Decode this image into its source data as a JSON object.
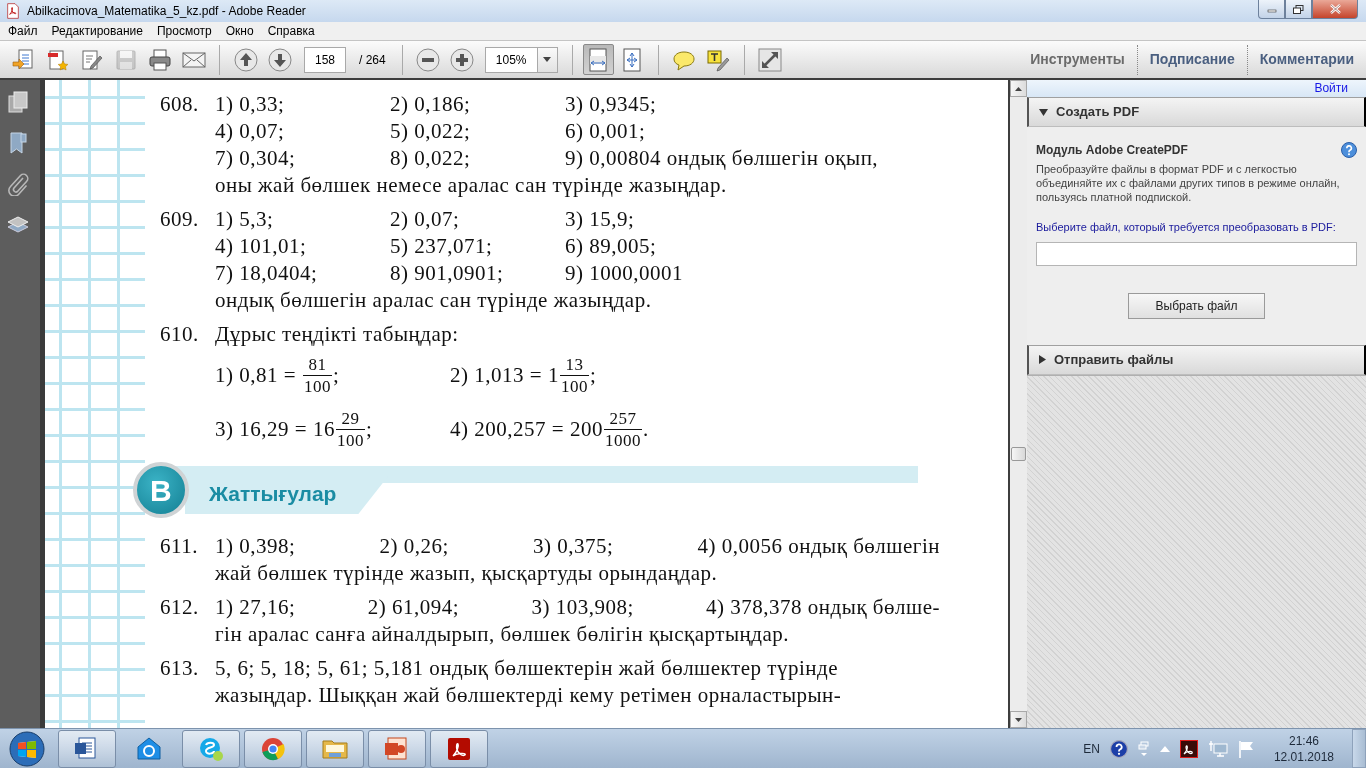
{
  "window": {
    "title": "Abilkacimova_Matematika_5_kz.pdf - Adobe Reader"
  },
  "menu": [
    "Файл",
    "Редактирование",
    "Просмотр",
    "Окно",
    "Справка"
  ],
  "toolbar": {
    "groups": [
      [
        {
          "kind": "create",
          "disabled": false,
          "pressed": false
        },
        {
          "kind": "convert",
          "disabled": false,
          "pressed": false
        },
        {
          "kind": "edit",
          "disabled": false,
          "pressed": false
        },
        {
          "kind": "save",
          "disabled": true,
          "pressed": false
        },
        {
          "kind": "print",
          "disabled": false,
          "pressed": false
        },
        {
          "kind": "email",
          "disabled": false,
          "pressed": false
        }
      ],
      [
        {
          "kind": "prev",
          "disabled": false,
          "pressed": false
        },
        {
          "kind": "next",
          "disabled": false,
          "pressed": false
        }
      ],
      [
        {
          "kind": "zoom-out",
          "disabled": false,
          "pressed": false
        },
        {
          "kind": "zoom-in",
          "disabled": false,
          "pressed": false
        }
      ],
      [
        {
          "kind": "fit-width",
          "disabled": false,
          "pressed": true
        },
        {
          "kind": "fit-page",
          "disabled": false,
          "pressed": false
        }
      ],
      [
        {
          "kind": "comment",
          "disabled": false,
          "pressed": false
        },
        {
          "kind": "highlight",
          "disabled": false,
          "pressed": false
        }
      ],
      [
        {
          "kind": "fullscreen",
          "disabled": false,
          "pressed": false
        }
      ]
    ],
    "page": "158",
    "page_total": "/ 264",
    "zoom": "105%"
  },
  "tabs": [
    {
      "label": "Инструменты",
      "selected": true
    },
    {
      "label": "Подписание",
      "selected": false
    },
    {
      "label": "Комментарии",
      "selected": false
    }
  ],
  "sign_in": "Войти",
  "panels": [
    {
      "title": "Создать PDF",
      "expanded": true,
      "heading": "Модуль Adobe CreatePDF",
      "description": "Преобразуйте файлы в формат PDF и с легкостью объединяйте их с файлами других типов в режиме онлайн, пользуясь платной подпиской.",
      "prompt": "Выберите файл, который требуется преобразовать в PDF:",
      "button": "Выбрать файл"
    },
    {
      "title": "Отправить файлы",
      "expanded": false
    }
  ],
  "document": {
    "items": [
      {
        "kind": "exercise",
        "number": "608.",
        "parts": [
          {
            "kind": "row",
            "cells": [
              "1) 0,33;",
              "2) 0,186;",
              "3) 0,9345;"
            ]
          },
          {
            "kind": "row",
            "cells": [
              "4) 0,07;",
              "5) 0,022;",
              "6) 0,001;"
            ]
          },
          {
            "kind": "row",
            "cells": [
              "7) 0,304;",
              "8) 0,022;",
              "9) 0,00804 ондық бөлшегін оқып,"
            ]
          },
          {
            "kind": "text",
            "text": "оны жай бөлшек немесе аралас сан түрінде жазыңдар."
          }
        ]
      },
      {
        "kind": "exercise",
        "number": "609.",
        "parts": [
          {
            "kind": "row",
            "cells": [
              "1) 5,3;",
              "2) 0,07;",
              "3) 15,9;"
            ]
          },
          {
            "kind": "row",
            "cells": [
              "4) 101,01;",
              "5) 237,071;",
              "6) 89,005;"
            ]
          },
          {
            "kind": "row",
            "cells": [
              "7) 18,0404;",
              "8) 901,0901;",
              "9) 1000,0001"
            ]
          },
          {
            "kind": "text",
            "text": "ондық бөлшегін аралас сан түрінде жазыңдар."
          }
        ]
      },
      {
        "kind": "exercise",
        "number": "610.",
        "parts": [
          {
            "kind": "text",
            "text": "Дұрыс теңдікті табыңдар:"
          },
          {
            "kind": "fractions",
            "items": [
              {
                "label": "1) 0,81 =",
                "num": "81",
                "den": "100",
                "tail": ";"
              },
              {
                "label": "2) 1,013 =",
                "whole": "1",
                "num": "13",
                "den": "100",
                "tail": ";"
              }
            ]
          },
          {
            "kind": "fractions",
            "items": [
              {
                "label": "3) 16,29 =",
                "whole": "16",
                "num": "29",
                "den": "100",
                "tail": ";"
              },
              {
                "label": "4) 200,257 =",
                "whole": "200",
                "num": "257",
                "den": "1000",
                "tail": "."
              }
            ]
          }
        ]
      },
      {
        "kind": "section",
        "badge": "B",
        "title": "Жаттығулар"
      },
      {
        "kind": "exercise",
        "number": "611.",
        "parts": [
          {
            "kind": "row",
            "cells": [
              "1) 0,398;",
              "2) 0,26;",
              "3) 0,375;",
              "4) 0,0056 ондық бөлшегін"
            ]
          },
          {
            "kind": "text",
            "text": "жай бөлшек түрінде жазып, қысқартуды орындаңдар."
          }
        ]
      },
      {
        "kind": "exercise",
        "number": "612.",
        "parts": [
          {
            "kind": "row",
            "cells": [
              "1) 27,16;",
              "2) 61,094;",
              "3) 103,908;",
              "4) 378,378 ондық бөлше-"
            ]
          },
          {
            "kind": "text",
            "text": "гін аралас санға айналдырып, бөлшек бөлігін қысқартыңдар."
          }
        ]
      },
      {
        "kind": "exercise",
        "number": "613.",
        "parts": [
          {
            "kind": "text",
            "text": "5, 6; 5, 18; 5, 61; 5,181 ондық бөлшектерін жай бөлшектер түрінде"
          },
          {
            "kind": "text",
            "text": "жазыңдар. Шыққан жай бөлшектерді кему ретімен орналастырын-"
          }
        ]
      }
    ]
  },
  "taskbar": {
    "apps": [
      {
        "kind": "word",
        "running": true
      },
      {
        "kind": "mail",
        "running": false
      },
      {
        "kind": "skype",
        "running": true
      },
      {
        "kind": "chrome",
        "running": true
      },
      {
        "kind": "folder",
        "running": true
      },
      {
        "kind": "powerpoint",
        "running": true
      },
      {
        "kind": "acrobat",
        "running": true
      }
    ],
    "language": "EN",
    "time": "21:46",
    "date": "12.01.2018"
  }
}
